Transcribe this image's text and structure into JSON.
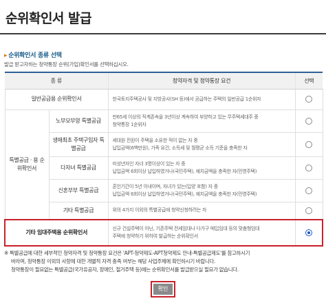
{
  "page": {
    "title": "순위확인서 발급"
  },
  "section": {
    "title": "순위확인서 종류 선택",
    "description": "발급 받고자하는 청약통장 순위(가입)확인서를 선택하십시오."
  },
  "table": {
    "headers": {
      "kind": "종 류",
      "requirement": "청약자격 및 청약통장 요건",
      "select": "선택"
    },
    "general": {
      "label": "일반공급용 순위확인서",
      "requirement": "한국토지주택공사 및 지방공사(SH 등)에서 공급하는 주택의 일반공급 1순위자"
    },
    "special_group": "특별공급 · 용 순위확인서",
    "special_rows": [
      {
        "label": "노부모부양 특별공급",
        "req1": "만65세 이상의 직계존속을 3년이상 계속하여 부양하고 있는 무주택세대주 중",
        "req2": "청약통장 1순위자"
      },
      {
        "label": "생애최초 주택구입자 특별공급",
        "req1": "세대원 전원이 주택을 소유한 적이 없는 자 중",
        "req2": "납입금액(6백만원), 가족 요건, 소득세 및 월평균 소득 기준을 충족한 자"
      },
      {
        "label": "다자녀 특별공급",
        "req1": "미성년자인 자녀 3명이상이 있는 자 중",
        "req2": "납입금액 6회이상 납입하였거나(국민주택), 예치금액을 충족한 자(민영주택)"
      },
      {
        "label": "신혼부부 특별공급",
        "req1": "혼인기간이 5년 이내이며, 자녀가 있는(입양 포함) 자 중",
        "req2": "납입금액 6회이상 납입하였거나(국민주택), 예치금액을 충족한 자(민영주택)"
      },
      {
        "label": "기타 특별공급",
        "req1": "위의 4가지 이외의 특별공급에 청약신청하려는 자",
        "req2": ""
      }
    ],
    "rental": {
      "label": "기타 임대주택용 순위확인서",
      "req1": "신규 건설주택이 아닌, 기존주택 전세임대나 다가구 매입임대 등의 맞춤형임대",
      "req2": "주택에 청약하기 위하여 발급하는 순위확인서"
    }
  },
  "notes": {
    "line1": "※ 특별공급에 대한 세부적인 청약자격 및 청약통장 요건은 'APT-청약제도-APT청약제도 안내-특별공급제도'를 참고하시기",
    "line2": "바라며, 청약통장 이외의 사항에 대한 개별적 자격 충족 여부는 해당 사업주체에 확인하시기 바랍니다.",
    "line3": "청약통장이 필요없는 특별공급(국가유공자, 장애인, 철거주택 등)에는 순위확인서를 발급받으실 필요가 없습니다."
  },
  "actions": {
    "confirm": "확인"
  },
  "colors": {
    "accent_blue": "#2f5f96",
    "highlight_red": "#c8202a",
    "button_gray": "#8a8a8a"
  }
}
